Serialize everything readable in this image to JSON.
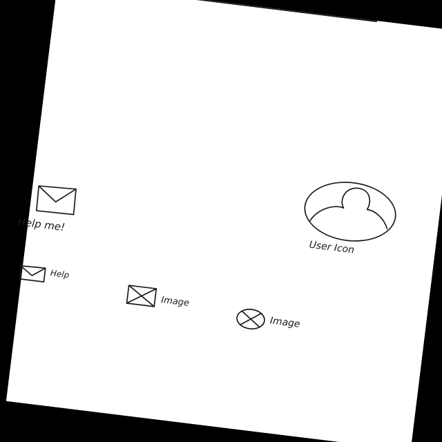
{
  "main": {
    "help_button": {
      "label": "Help me!",
      "icon": "envelope-icon"
    },
    "user": {
      "label": "User Icon",
      "icon": "user-avatar-icon"
    }
  },
  "bottom_nav": {
    "items": [
      {
        "label": "Help",
        "icon": "envelope-icon"
      },
      {
        "label": "Image",
        "icon": "image-placeholder-icon"
      },
      {
        "label": "Image",
        "icon": "image-circle-placeholder-icon"
      }
    ]
  },
  "colors": {
    "background": "#000000",
    "paper": "#ffffff",
    "ink": "#1b1b1b"
  }
}
